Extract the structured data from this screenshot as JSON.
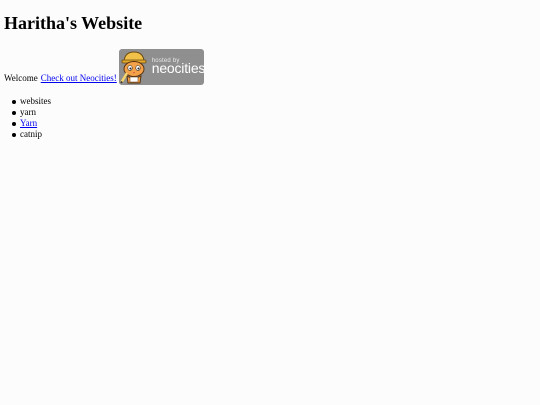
{
  "page": {
    "title": "Haritha's Website"
  },
  "welcome": {
    "text": "Welcome",
    "link_text": "Check out Neocities!"
  },
  "badge": {
    "hosted_by": "hosted by",
    "name": "neocities"
  },
  "list": {
    "items": [
      {
        "label": "websites",
        "is_link": false
      },
      {
        "label": "yarn",
        "is_link": false
      },
      {
        "label": "Yarn",
        "is_link": true
      },
      {
        "label": "catnip",
        "is_link": false
      }
    ]
  }
}
